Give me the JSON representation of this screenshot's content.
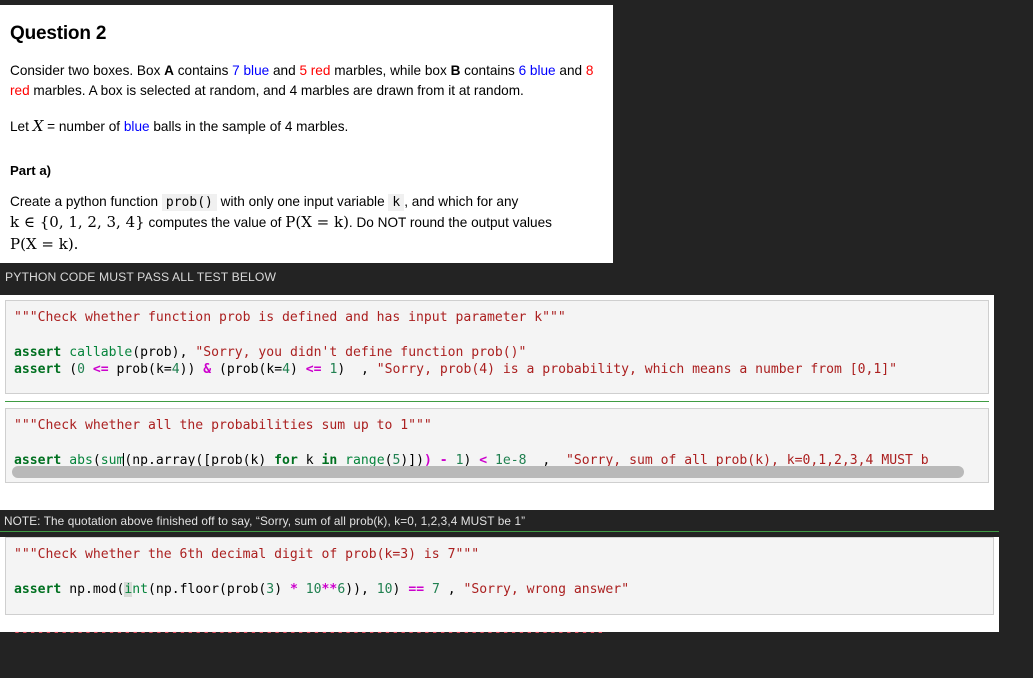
{
  "question": {
    "title": "Question 2",
    "intro_1": "Consider two boxes. Box ",
    "box_a": "A",
    "intro_2": " contains ",
    "a_blue": "7 blue",
    "intro_3": " and ",
    "a_red": "5 red",
    "intro_4": " marbles, while box ",
    "box_b": "B",
    "intro_5": " contains ",
    "b_blue": "6 blue",
    "intro_6": " and ",
    "b_red": "8 red",
    "intro_7": " marbles. A box is selected at random, and 4 marbles are drawn from it at random.",
    "let_1": "Let ",
    "let_X": "X",
    "let_2": " = number of ",
    "let_blue": "blue",
    "let_3": " balls in the sample of 4 marbles.",
    "part_heading": "Part a)",
    "part_1": "Create a python function ",
    "code_prob": "prob()",
    "part_2": " with only one input variable ",
    "code_k": "k",
    "part_3": ", and which for any",
    "math_line2": "k ∈ {0, 1, 2, 3, 4}",
    "part_4": " computes the value of ",
    "math_pxk": "P(X = k)",
    "part_5": ". Do NOT round the output values",
    "math_line3": "P(X = k).",
    "colors": {
      "blue": "#0000ff",
      "red": "#ff0000"
    }
  },
  "banner": {
    "text": "PYTHON CODE MUST PASS ALL TEST BELOW"
  },
  "cells": [
    {
      "id": "test-cell-1",
      "docstring": "\"\"\"Check whether function prob is defined and has input parameter k\"\"\"",
      "lines": [
        {
          "tokens": [
            {
              "t": "assert ",
              "c": "kw"
            },
            {
              "t": "callable",
              "c": "fn"
            },
            {
              "t": "(prob), ",
              "c": "plain"
            },
            {
              "t": "\"Sorry, you didn't define function prob()\"",
              "c": "str"
            }
          ]
        },
        {
          "tokens": [
            {
              "t": "assert ",
              "c": "kw"
            },
            {
              "t": "(",
              "c": "plain"
            },
            {
              "t": "0",
              "c": "num"
            },
            {
              "t": " ",
              "c": "plain"
            },
            {
              "t": "<=",
              "c": "op"
            },
            {
              "t": " prob(k=",
              "c": "plain"
            },
            {
              "t": "4",
              "c": "num"
            },
            {
              "t": ")) ",
              "c": "plain"
            },
            {
              "t": "&",
              "c": "op"
            },
            {
              "t": " (prob(k=",
              "c": "plain"
            },
            {
              "t": "4",
              "c": "num"
            },
            {
              "t": ") ",
              "c": "plain"
            },
            {
              "t": "<=",
              "c": "op"
            },
            {
              "t": " ",
              "c": "plain"
            },
            {
              "t": "1",
              "c": "num"
            },
            {
              "t": ")  , ",
              "c": "plain"
            },
            {
              "t": "\"Sorry, prob(4) is a probability, which means a number from [0,1]\"",
              "c": "str"
            }
          ]
        }
      ],
      "has_scrollbar": false
    },
    {
      "id": "test-cell-2",
      "docstring": "\"\"\"Check whether all the probabilities sum up to 1\"\"\"",
      "lines": [
        {
          "tokens": [
            {
              "t": "assert ",
              "c": "kw"
            },
            {
              "t": "abs",
              "c": "fn"
            },
            {
              "t": "(",
              "c": "plain"
            },
            {
              "t": "sum",
              "c": "fn"
            },
            {
              "t": "",
              "c": "cursor"
            },
            {
              "t": "(np.array([prob(k) ",
              "c": "plain"
            },
            {
              "t": "for",
              "c": "kw"
            },
            {
              "t": " k ",
              "c": "plain"
            },
            {
              "t": "in",
              "c": "kw"
            },
            {
              "t": " ",
              "c": "plain"
            },
            {
              "t": "range",
              "c": "fn"
            },
            {
              "t": "(",
              "c": "plain"
            },
            {
              "t": "5",
              "c": "num"
            },
            {
              "t": ")])",
              "c": "plain"
            },
            {
              "t": ")",
              "c": "op"
            },
            {
              "t": " ",
              "c": "plain"
            },
            {
              "t": "-",
              "c": "op"
            },
            {
              "t": " ",
              "c": "plain"
            },
            {
              "t": "1",
              "c": "num"
            },
            {
              "t": ") ",
              "c": "plain"
            },
            {
              "t": "<",
              "c": "op"
            },
            {
              "t": " ",
              "c": "plain"
            },
            {
              "t": "1e-8",
              "c": "num"
            },
            {
              "t": "  ,  ",
              "c": "plain"
            },
            {
              "t": "\"Sorry, sum of all prob(k), k=0,1,2,3,4 MUST b",
              "c": "str"
            }
          ]
        }
      ],
      "has_scrollbar": true
    },
    {
      "id": "test-cell-3",
      "docstring": "\"\"\"Check whether the 6th decimal digit of prob(k=3) is 7\"\"\"",
      "lines": [
        {
          "tokens": [
            {
              "t": "assert ",
              "c": "kw"
            },
            {
              "t": "np.mod(",
              "c": "plain"
            },
            {
              "t": "i",
              "c": "fn hl"
            },
            {
              "t": "nt",
              "c": "fn"
            },
            {
              "t": "(np.floor(prob(",
              "c": "plain"
            },
            {
              "t": "3",
              "c": "num"
            },
            {
              "t": ") ",
              "c": "plain"
            },
            {
              "t": "*",
              "c": "op"
            },
            {
              "t": " ",
              "c": "plain"
            },
            {
              "t": "10",
              "c": "num"
            },
            {
              "t": "**",
              "c": "op"
            },
            {
              "t": "6",
              "c": "num"
            },
            {
              "t": ")), ",
              "c": "plain"
            },
            {
              "t": "10",
              "c": "num"
            },
            {
              "t": ") ",
              "c": "plain"
            },
            {
              "t": "==",
              "c": "op"
            },
            {
              "t": " ",
              "c": "plain"
            },
            {
              "t": "7",
              "c": "num"
            },
            {
              "t": " , ",
              "c": "plain"
            },
            {
              "t": "\"Sorry, wrong answer\"",
              "c": "str"
            }
          ]
        }
      ],
      "has_scrollbar": false
    }
  ],
  "note": {
    "text": "NOTE: The quotation above finished off to say, “Sorry, sum of all prob(k), k=0, 1,2,3,4 MUST be 1”"
  },
  "dash_rule": {
    "text": "---------------------------------------------------------------------------"
  }
}
